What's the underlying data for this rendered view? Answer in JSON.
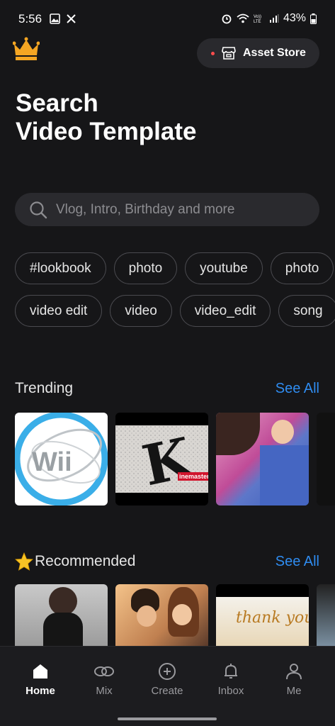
{
  "status": {
    "time": "5:56",
    "battery": "43%"
  },
  "header": {
    "asset_store_label": "Asset Store"
  },
  "title": {
    "line1": "Search",
    "line2": "Video Template"
  },
  "search": {
    "placeholder": "Vlog, Intro, Birthday and more"
  },
  "tags": {
    "row1": [
      "#lookbook",
      "photo",
      "youtube",
      "photo"
    ],
    "row2": [
      "video edit",
      "video",
      "video_edit",
      "song"
    ]
  },
  "trending": {
    "title": "Trending",
    "see_all": "See All",
    "items": [
      {
        "text": "Wii"
      },
      {
        "text": "K",
        "subtext": "inemaster"
      },
      {
        "text": ""
      }
    ]
  },
  "recommended": {
    "title": "Recommended",
    "see_all": "See All",
    "items": [
      {
        "text": ""
      },
      {
        "text": ""
      },
      {
        "text": "thank you"
      }
    ]
  },
  "nav": [
    {
      "label": "Home",
      "icon": "home-icon",
      "active": true
    },
    {
      "label": "Mix",
      "icon": "mix-icon"
    },
    {
      "label": "Create",
      "icon": "create-icon"
    },
    {
      "label": "Inbox",
      "icon": "bell-icon"
    },
    {
      "label": "Me",
      "icon": "person-icon"
    }
  ],
  "colors": {
    "accent": "#2f8cf0",
    "background": "#161618",
    "crown": "#f5a623"
  }
}
